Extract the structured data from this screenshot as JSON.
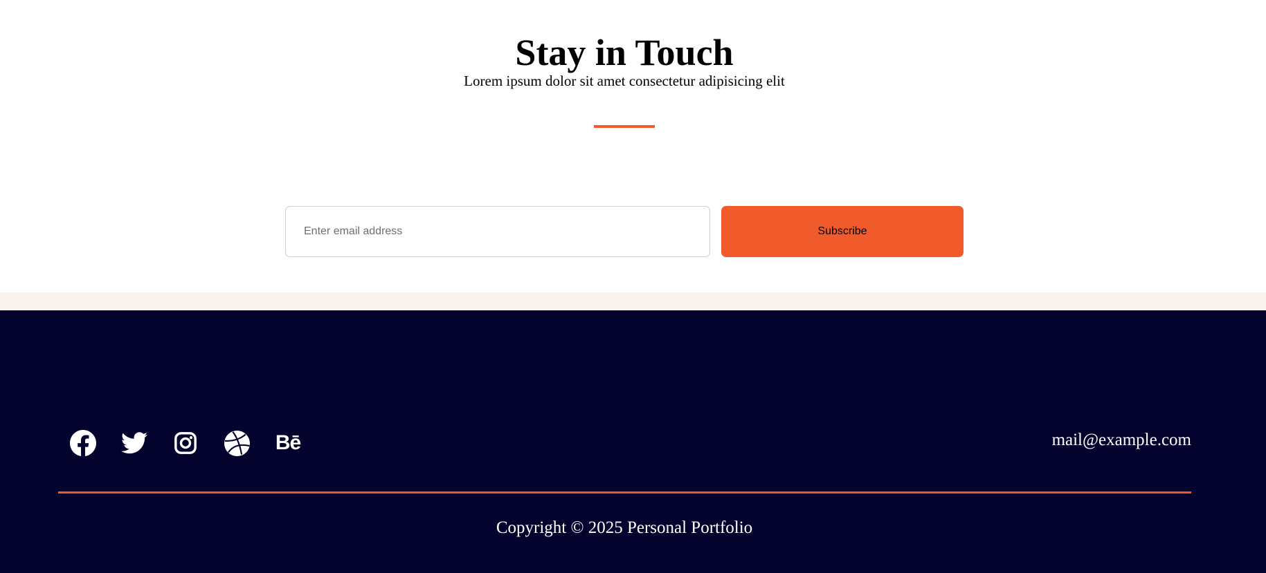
{
  "subscribe": {
    "title": "Stay in Touch",
    "subtitle": "Lorem ipsum dolor sit amet consectetur adipisicing elit",
    "email_placeholder": "Enter email address",
    "email_value": "",
    "button_label": "Subscribe"
  },
  "footer": {
    "social": [
      {
        "name": "facebook",
        "icon": "facebook-icon"
      },
      {
        "name": "twitter",
        "icon": "twitter-icon"
      },
      {
        "name": "instagram",
        "icon": "instagram-icon"
      },
      {
        "name": "dribbble",
        "icon": "dribbble-icon"
      },
      {
        "name": "behance",
        "icon": "behance-icon",
        "text": "Bē"
      }
    ],
    "email": "mail@example.com",
    "copyright": "Copyright © 2025 Personal Portfolio"
  },
  "colors": {
    "accent": "#f15a2b",
    "footer_background": "#03032e",
    "band_background": "#f9f2ef",
    "text_light": "#ffffff",
    "text_dark": "#000000"
  }
}
